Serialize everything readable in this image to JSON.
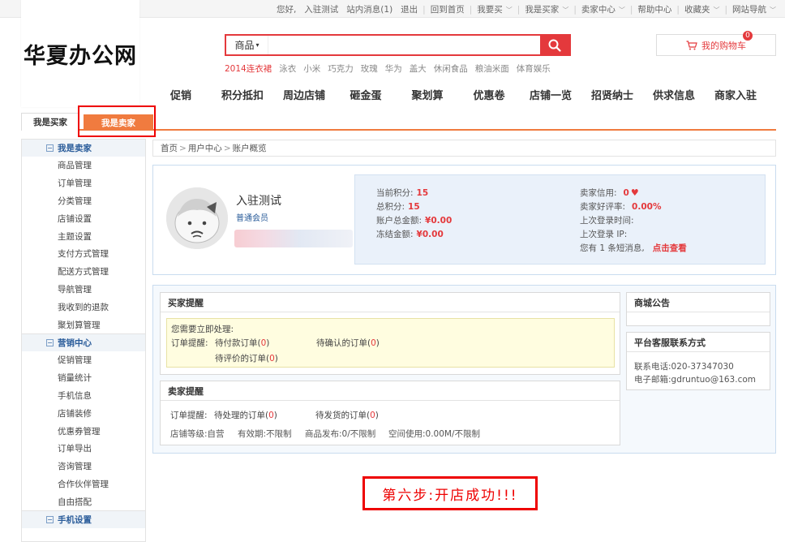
{
  "topbar": {
    "greeting": "您好,",
    "username": "入驻测试",
    "messages": "站内消息(1)",
    "logout": "退出",
    "home": "回到首页",
    "want_buy": "我要买",
    "im_buyer": "我是买家",
    "seller_center": "卖家中心",
    "help": "帮助中心",
    "favorites": "收藏夹",
    "site_nav": "网站导航"
  },
  "header": {
    "logo": "华夏办公网",
    "search_category": "商品",
    "search_placeholder": "",
    "hot_words": [
      "2014连衣裙",
      "泳衣",
      "小米",
      "巧克力",
      "玫瑰",
      "华为",
      "盖大",
      "休闲食品",
      "粮油米面",
      "体育娱乐"
    ],
    "cart_label": "我的购物车",
    "cart_count": "0"
  },
  "mainnav": [
    "促销",
    "积分抵扣",
    "周边店铺",
    "砸金蛋",
    "聚划算",
    "优惠卷",
    "店铺一览",
    "招贤纳士",
    "供求信息",
    "商家入驻"
  ],
  "tabs": {
    "buyer": "我是买家",
    "seller": "我是卖家"
  },
  "sidebar": {
    "groups": [
      {
        "title": "我是卖家",
        "items": [
          "商品管理",
          "订单管理",
          "分类管理",
          "店铺设置",
          "主题设置",
          "支付方式管理",
          "配送方式管理",
          "导航管理",
          "我收到的退款",
          "聚划算管理"
        ]
      },
      {
        "title": "营销中心",
        "items": [
          "促销管理",
          "销量统计",
          "手机信息",
          "店铺装修",
          "优惠券管理",
          "订单导出",
          "咨询管理",
          "合作伙伴管理",
          "自由搭配"
        ]
      },
      {
        "title": "手机设置",
        "items": []
      }
    ]
  },
  "breadcrumb": {
    "home": "首页",
    "gt": ">",
    "center": "用户中心",
    "current": "账户概览"
  },
  "profile": {
    "name": "入驻测试",
    "level": "普通会员",
    "current_points_label": "当前积分:",
    "current_points": "15",
    "total_points_label": "总积分:",
    "total_points": "15",
    "balance_label": "账户总金额:",
    "balance": "¥0.00",
    "frozen_label": "冻结金额:",
    "frozen": "¥0.00",
    "seller_credit_label": "卖家信用:",
    "seller_credit": "0",
    "good_rate_label": "卖家好评率:",
    "good_rate": "0.00%",
    "last_login_time_label": "上次登录时间:",
    "last_login_ip_label": "上次登录 IP:",
    "msg_text": "您有 1 条短消息,",
    "msg_link": "点击查看"
  },
  "buyer_reminder": {
    "title": "买家提醒",
    "need_handle": "您需要立即处理:",
    "order_reminder": "订单提醒:",
    "pending_pay": "待付款订单",
    "pending_pay_count": "0",
    "pending_confirm": "待确认的订单",
    "pending_confirm_count": "0",
    "pending_review": "待评价的订单",
    "pending_review_count": "0"
  },
  "seller_reminder": {
    "title": "卖家提醒",
    "order_reminder": "订单提醒:",
    "pending_process": "待处理的订单",
    "pending_process_count": "0",
    "pending_ship": "待发货的订单",
    "pending_ship_count": "0",
    "shop_level": "店铺等级:自营",
    "validity": "有效期:不限制",
    "goods_publish": "商品发布:0/不限制",
    "space_used": "空间使用:0.00M/不限制"
  },
  "notice": {
    "title": "商城公告"
  },
  "service": {
    "title": "平台客服联系方式",
    "phone": "联系电话:020-37347030",
    "email": "电子邮箱:gdruntuo@163.com"
  },
  "step_label": "第六步:开店成功!!!",
  "colors": {
    "accent": "#e4393c",
    "orange": "#f07b3f",
    "link_blue": "#2a5c9a"
  }
}
